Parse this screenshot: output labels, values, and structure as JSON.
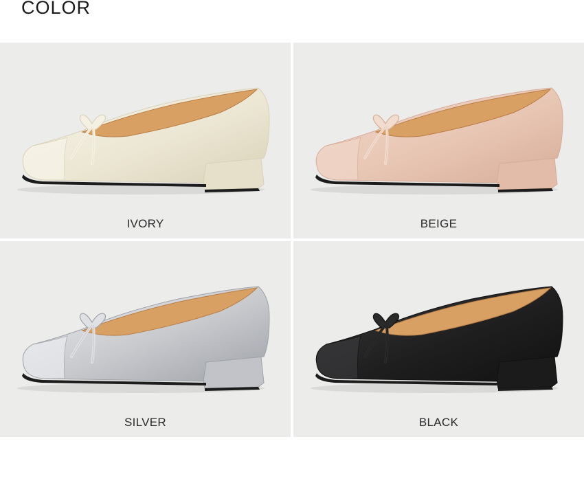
{
  "section": {
    "title": "COLOR"
  },
  "swatches": [
    {
      "label": "IVORY",
      "colors": {
        "body": "#ece7d4",
        "shade": "#d9d2b9",
        "light": "#f8f5ea",
        "bow": "#f4f0e2",
        "heel": "#e6e0cb"
      }
    },
    {
      "label": "BEIGE",
      "colors": {
        "body": "#e8c6b4",
        "shade": "#d6ad98",
        "light": "#f1d8ca",
        "bow": "#f2dccf",
        "heel": "#e2bca8"
      }
    },
    {
      "label": "SILVER",
      "colors": {
        "body": "#c7c9cd",
        "shade": "#9ea1a7",
        "light": "#eceef1",
        "bow": "#dfe1e4",
        "heel": "#c1c3c8"
      }
    },
    {
      "label": "BLACK",
      "colors": {
        "body": "#1f1f20",
        "shade": "#111112",
        "light": "#3a3a3c",
        "bow": "#2a2a2b",
        "heel": "#1b1b1c"
      }
    }
  ],
  "common": {
    "lining": "#d9a063",
    "lining_dark": "#b97d43",
    "sole": "#1c1c1c",
    "background": "#ececeb"
  }
}
